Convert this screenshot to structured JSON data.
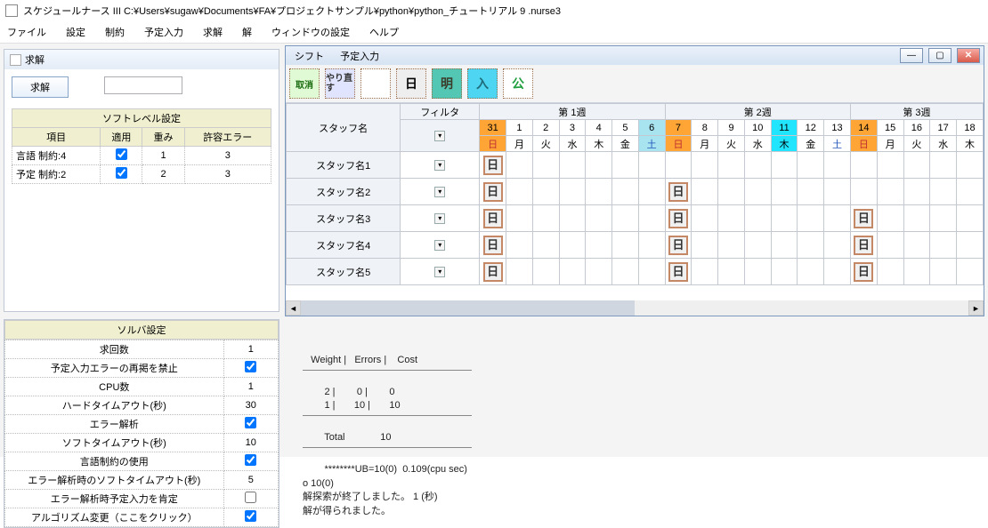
{
  "app_title": "スケジュールナース III   C:¥Users¥sugaw¥Documents¥FA¥プロジェクトサンプル¥python¥python_チュートリアル 9 .nurse3",
  "menu": {
    "file": "ファイル",
    "setting": "設定",
    "constraint": "制約",
    "schedule": "予定入力",
    "solve": "求解",
    "res": "解",
    "winset": "ウィンドウの設定",
    "help": "ヘルプ"
  },
  "kokai": {
    "title": "求解",
    "button": "求解",
    "soft_title": "ソフトレベル設定",
    "cols": {
      "item": "項目",
      "apply": "適用",
      "weight": "重み",
      "allow": "許容エラー"
    },
    "rows": [
      {
        "item": "言語 制約:4",
        "apply": true,
        "weight": "1",
        "allow": "3"
      },
      {
        "item": "予定 制約:2",
        "apply": true,
        "weight": "2",
        "allow": "3"
      }
    ]
  },
  "solver": {
    "title": "ソルバ設定",
    "rows": [
      {
        "label": "求回数",
        "val": "1"
      },
      {
        "label": "予定入力エラーの再掲を禁止",
        "chk": true
      },
      {
        "label": "CPU数",
        "val": "1"
      },
      {
        "label": "ハードタイムアウト(秒)",
        "val": "30"
      },
      {
        "label": "エラー解析",
        "chk": true
      },
      {
        "label": "ソフトタイムアウト(秒)",
        "val": "10"
      },
      {
        "label": "言語制約の使用",
        "chk": true
      },
      {
        "label": "エラー解析時のソフトタイムアウト(秒)",
        "val": "5"
      },
      {
        "label": "エラー解析時予定入力を肯定",
        "chk": false
      },
      {
        "label": "アルゴリズム変更（ここをクリック）",
        "chk": true
      }
    ]
  },
  "sub": {
    "tab_shift": "シフト",
    "tab_schedule": "予定入力",
    "tool": {
      "cancel": "取消",
      "redo": "やり直す",
      "blank": "",
      "day": "日",
      "morning": "明",
      "enter": "入",
      "holiday": "公"
    },
    "cols": {
      "staff": "スタッフ名",
      "filter": "フィルタ",
      "week1": "第 1週",
      "week2": "第 2週",
      "week3": "第 3週"
    },
    "dates": [
      "31",
      "1",
      "2",
      "3",
      "4",
      "5",
      "6",
      "7",
      "8",
      "9",
      "10",
      "11",
      "12",
      "13",
      "14",
      "15",
      "16",
      "17",
      "18"
    ],
    "days": [
      "日",
      "月",
      "火",
      "水",
      "木",
      "金",
      "土",
      "日",
      "月",
      "火",
      "水",
      "木",
      "金",
      "土",
      "日",
      "月",
      "火",
      "水",
      "木"
    ],
    "staff": [
      "スタッフ名1",
      "スタッフ名2",
      "スタッフ名3",
      "スタッフ名4",
      "スタッフ名5"
    ],
    "chip": "日",
    "cells": [
      [
        [
          0,
          "日"
        ]
      ],
      [
        [
          0,
          "日"
        ],
        [
          7,
          "日"
        ]
      ],
      [
        [
          0,
          "日"
        ],
        [
          7,
          "日"
        ],
        [
          14,
          "日"
        ]
      ],
      [
        [
          0,
          "日"
        ],
        [
          7,
          "日"
        ],
        [
          14,
          "日"
        ]
      ],
      [
        [
          0,
          "日"
        ],
        [
          7,
          "日"
        ],
        [
          14,
          "日"
        ]
      ]
    ]
  },
  "console": {
    "hdr_weight": "Weight",
    "hdr_errors": "Errors",
    "hdr_cost": "Cost",
    "l1": "        2 |        0 |        0",
    "l2": "        1 |       10 |       10",
    "total_label": "Total",
    "total_val": "10",
    "ub": "        ********UB=10(0)  0.109(cpu sec)",
    "o": "o 10(0)",
    "done": "解探索が終了しました。 1 (秒)",
    "got": "解が得られました。"
  }
}
